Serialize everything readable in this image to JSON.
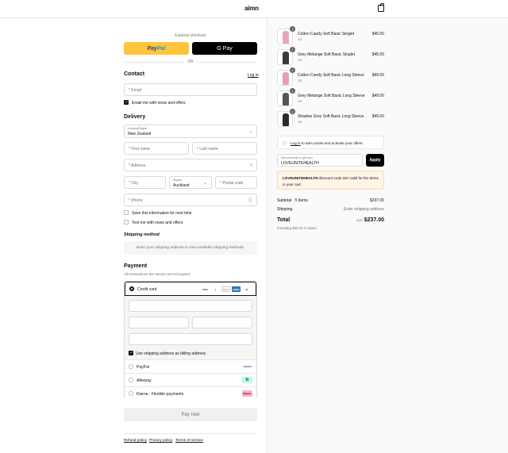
{
  "header": {
    "logo": "aimn"
  },
  "express": {
    "label": "Express checkout",
    "paypal": [
      "Pay",
      "Pal"
    ],
    "gpay": "G Pay",
    "or": "OR"
  },
  "contact": {
    "title": "Contact",
    "login": "Log in",
    "email_ph": "* Email",
    "email_news": "Email me with news and offers"
  },
  "delivery": {
    "title": "Delivery",
    "country_label": "Country/Region",
    "country_value": "New Zealand",
    "first_ph": "* First name",
    "last_ph": "* Last name",
    "address_ph": "* Address",
    "city_ph": "* City",
    "region_label": "Region",
    "region_value": "Auckland",
    "postal_ph": "* Postal code",
    "phone_ph": "* Phone",
    "save_info": "Save this information for next time",
    "text_news": "Text me with news and offers"
  },
  "shipping": {
    "title": "Shipping method",
    "info": "Enter your shipping address to view available shipping methods."
  },
  "payment": {
    "title": "Payment",
    "subtitle": "All transactions are secure and encrypted.",
    "credit_card": "Credit card",
    "cards": [
      "VISA",
      "MC",
      "DISC",
      "AMEX",
      "+5"
    ],
    "billing": "Use shipping address as billing address",
    "methods": [
      {
        "name": "PayPal",
        "logo": "PayPal"
      },
      {
        "name": "Afterpay",
        "logo": "↻"
      },
      {
        "name": "Klarna - Flexible payments",
        "logo": "Klarna."
      }
    ],
    "pay_now": "Pay now"
  },
  "footer": {
    "links": [
      "Refund policy",
      "Privacy policy",
      "Terms of service"
    ]
  },
  "cart": {
    "items": [
      {
        "name": "Cotton Candy Soft Basic Singlet",
        "size": "XS",
        "qty": "1",
        "price": "$45.00",
        "color": "#e8a7b8"
      },
      {
        "name": "Grey Melange Soft Basic Singlet",
        "size": "XS",
        "qty": "1",
        "price": "$45.00",
        "color": "#3a3a3a"
      },
      {
        "name": "Cotton Candy Soft Basic Long Sleeve",
        "size": "XS",
        "qty": "1",
        "price": "$49.00",
        "color": "#e3a0b4"
      },
      {
        "name": "Grey Melange Soft Basic Long Sleeve",
        "size": "XS",
        "qty": "1",
        "price": "$49.00",
        "color": "#555555"
      },
      {
        "name": "Shadow Grey Soft Basic Long Sleeve",
        "size": "XS",
        "qty": "1",
        "price": "$49.00",
        "color": "#2a2a2a"
      }
    ],
    "points_link": "Log in",
    "points_text": " to earn points and activate your offers.",
    "discount_label": "Discount code or gift card",
    "discount_value": "LOVEUNITEHEALTH",
    "apply": "Apply",
    "error_code": "LOVEUNITEHEALTH",
    "error_text": " discount code isn't valid for the items in your cart",
    "subtotal_label": "Subtotal · 5 items",
    "subtotal_value": "$237.00",
    "shipping_label": "Shipping",
    "shipping_value": "Enter shipping address",
    "total_label": "Total",
    "total_currency": "NZD",
    "total_value": "$237.00",
    "taxes": "Including $30.91 in taxes"
  }
}
